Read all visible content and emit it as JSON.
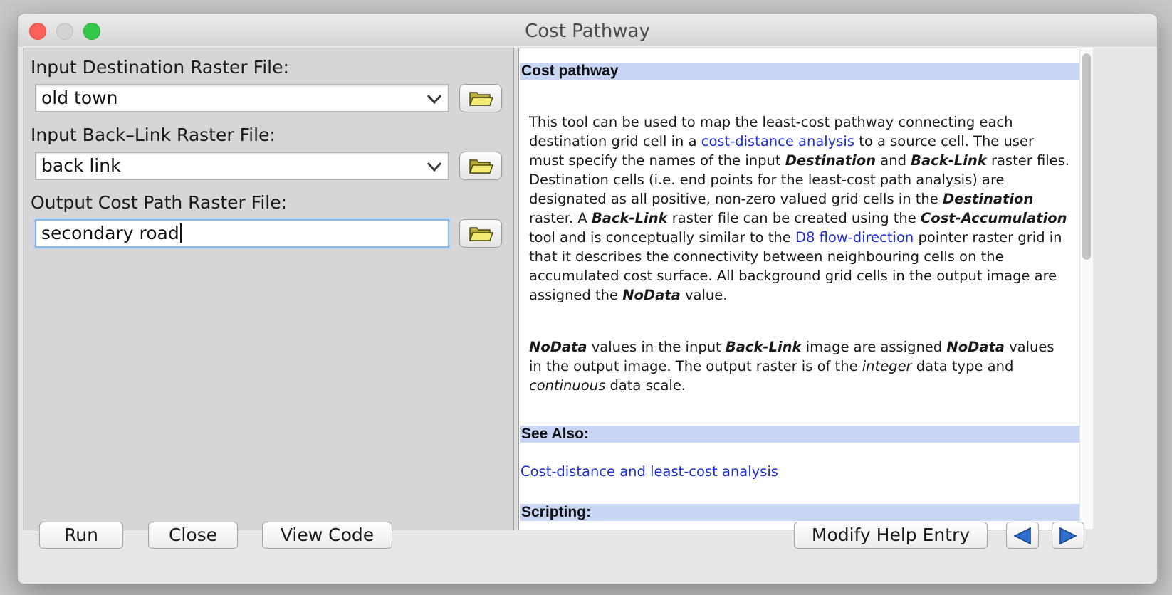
{
  "window": {
    "title": "Cost Pathway"
  },
  "form": {
    "destination": {
      "label": "Input Destination Raster File:",
      "value": "old town"
    },
    "backlink": {
      "label": "Input Back–Link Raster File:",
      "value": "back link"
    },
    "output": {
      "label": "Output Cost Path Raster File:",
      "value": "secondary road"
    }
  },
  "help": {
    "heading": "Cost pathway",
    "para1": {
      "t1": "This tool can be used to map the least-cost pathway connecting each destination grid cell in a ",
      "link1": "cost-distance analysis",
      "t2": " to a source cell. The user must specify the names of the input ",
      "b1": "Destination",
      "t3": " and ",
      "b2": "Back-Link",
      "t4": " raster files. Destination cells (i.e. end points for the least-cost path analysis) are designated as all positive, non-zero valued grid cells in the ",
      "b3": "Destination",
      "t5": " raster. A ",
      "b4": "Back-Link",
      "t6": " raster file can be created using the ",
      "b5": "Cost-Accumulation",
      "t7": " tool and is conceptually similar to the ",
      "link2": "D8 flow-direction",
      "t8": " pointer raster grid in that it describes the connectivity between neighbouring cells on the accumulated cost surface. All background grid cells in the output image are assigned the ",
      "b6": "NoData",
      "t9": " value."
    },
    "para2": {
      "b1": "NoData",
      "t1": " values in the input ",
      "b2": "Back-Link",
      "t2": " image are assigned ",
      "b3": "NoData",
      "t3": " values in the output image. The output raster is of the ",
      "i1": "integer",
      "t4": " data type and ",
      "i2": "continuous",
      "t5": " data scale."
    },
    "see_also_heading": "See Also:",
    "see_also_link": "Cost-distance and least-cost analysis",
    "scripting_heading": "Scripting:"
  },
  "buttons": {
    "run": "Run",
    "close": "Close",
    "view_code": "View Code",
    "modify_help": "Modify Help Entry"
  },
  "icons": {
    "folder": "folder-open-icon",
    "chevron": "chevron-down-icon",
    "prev": "arrow-left-icon",
    "next": "arrow-right-icon"
  },
  "colors": {
    "heading_bg": "#c8d5f5",
    "link": "#1f2fd1",
    "focus_ring": "#86b7ea",
    "arrow": "#2f6fd0"
  }
}
